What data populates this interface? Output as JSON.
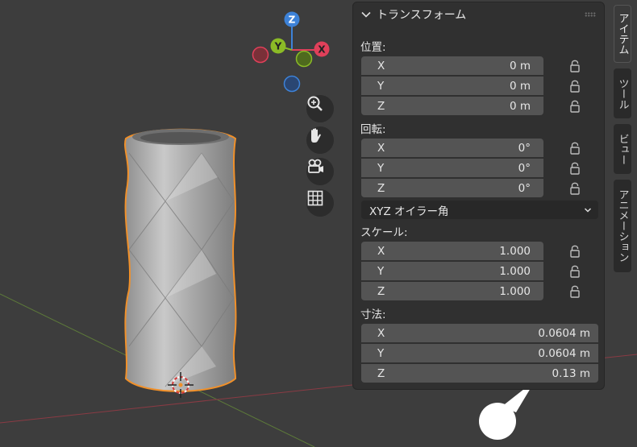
{
  "gizmo": {
    "z": "Z",
    "y": "Y",
    "x": "X"
  },
  "panel": {
    "title": "トランスフォーム",
    "location": {
      "label": "位置:",
      "rows": [
        {
          "axis": "X",
          "value": "0 m"
        },
        {
          "axis": "Y",
          "value": "0 m"
        },
        {
          "axis": "Z",
          "value": "0 m"
        }
      ]
    },
    "rotation": {
      "label": "回転:",
      "rows": [
        {
          "axis": "X",
          "value": "0°"
        },
        {
          "axis": "Y",
          "value": "0°"
        },
        {
          "axis": "Z",
          "value": "0°"
        }
      ]
    },
    "rotation_mode": "XYZ オイラー角",
    "scale": {
      "label": "スケール:",
      "rows": [
        {
          "axis": "X",
          "value": "1.000"
        },
        {
          "axis": "Y",
          "value": "1.000"
        },
        {
          "axis": "Z",
          "value": "1.000"
        }
      ]
    },
    "dimensions": {
      "label": "寸法:",
      "rows": [
        {
          "axis": "X",
          "value": "0.0604 m"
        },
        {
          "axis": "Y",
          "value": "0.0604 m"
        },
        {
          "axis": "Z",
          "value": "0.13 m"
        }
      ]
    }
  },
  "tabs": [
    "アイテム",
    "ツール",
    "ビュー",
    "アニメーション"
  ],
  "colors": {
    "x_axis": "#e0405a",
    "y_axis": "#8bbb26",
    "z_axis": "#3d82d8",
    "selection": "#f0902a"
  }
}
